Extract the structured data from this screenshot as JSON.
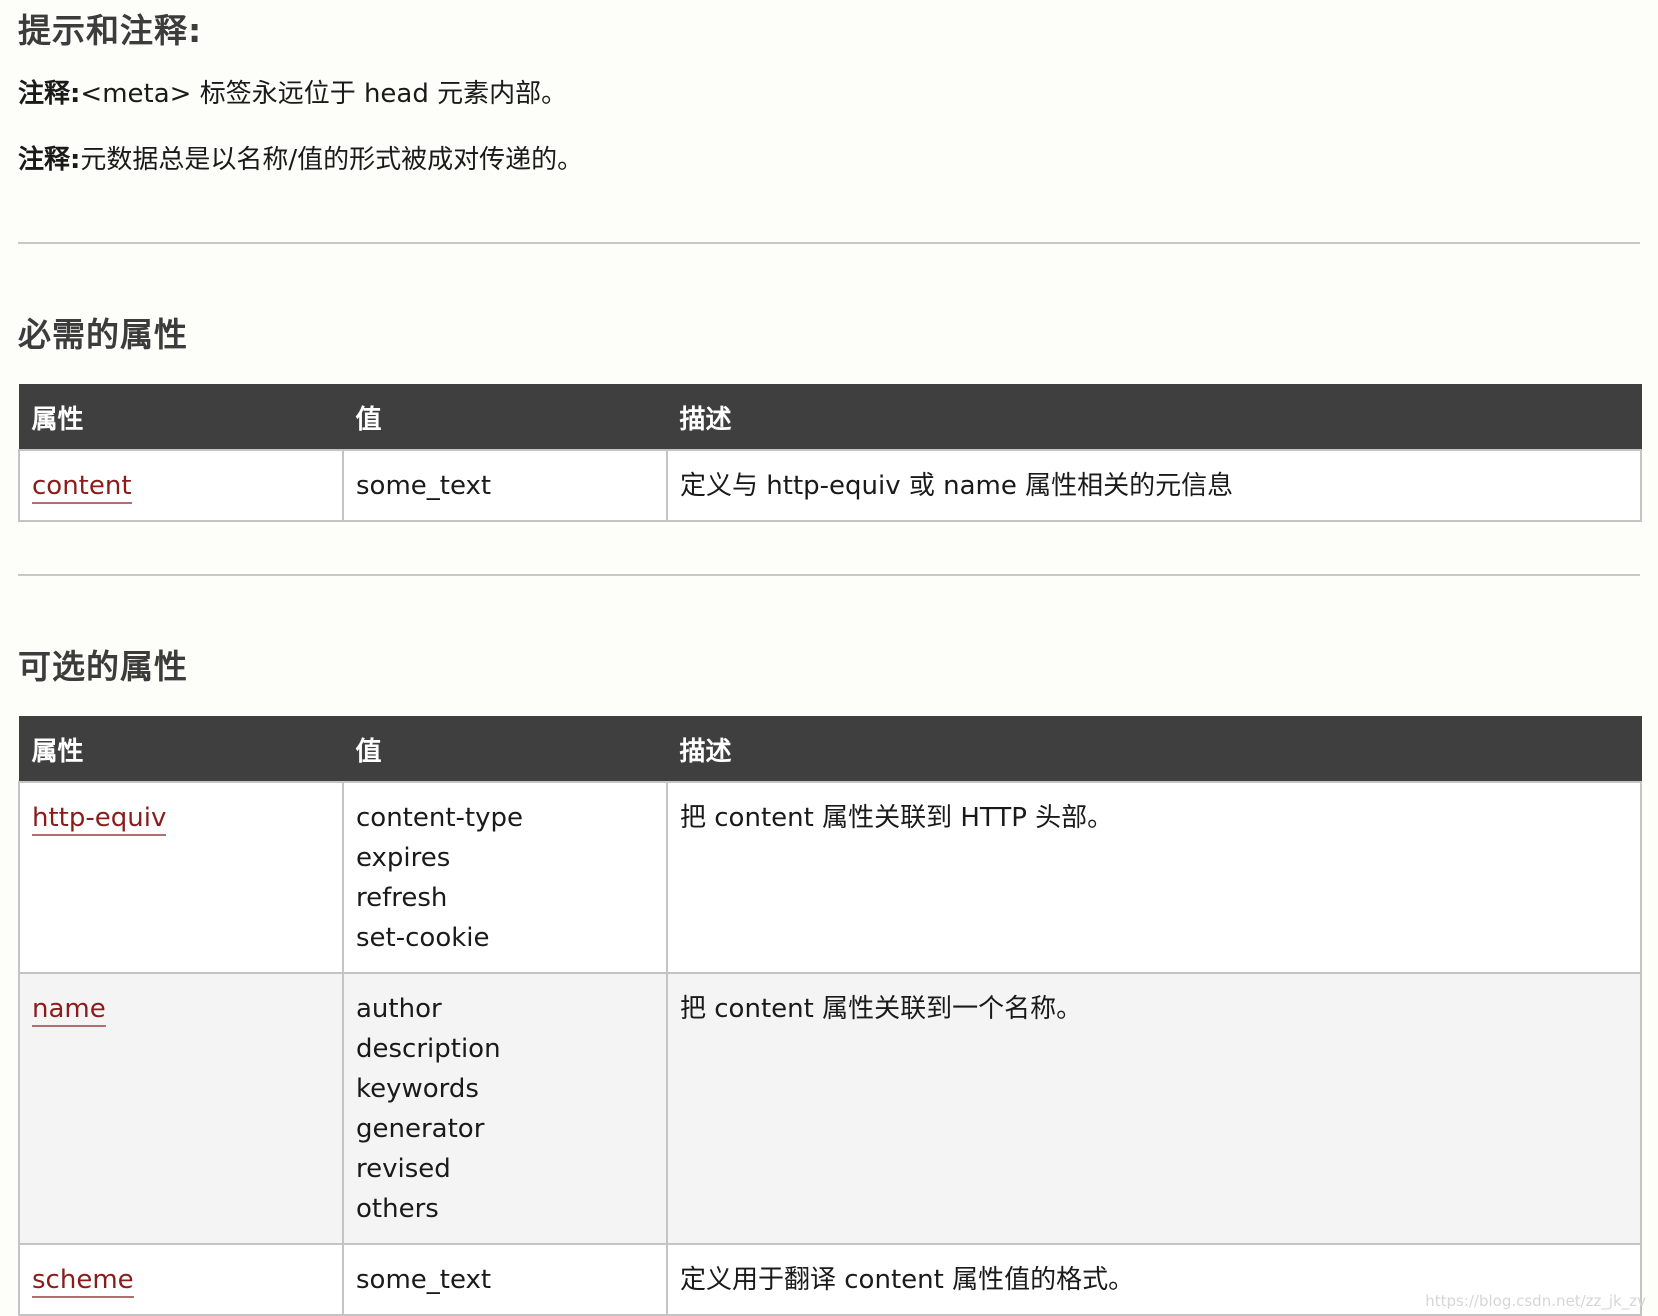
{
  "tips": {
    "title": "提示和注释:",
    "notes": [
      {
        "label": "注释:",
        "text": "<meta> 标签永远位于 head 元素内部。"
      },
      {
        "label": "注释:",
        "text": "元数据总是以名称/值的形式被成对传递的。"
      }
    ]
  },
  "required": {
    "title": "必需的属性",
    "headers": {
      "attr": "属性",
      "value": "值",
      "desc": "描述"
    },
    "rows": [
      {
        "attr": "content",
        "values": [
          "some_text"
        ],
        "desc": "定义与 http-equiv 或 name 属性相关的元信息"
      }
    ]
  },
  "optional": {
    "title": "可选的属性",
    "headers": {
      "attr": "属性",
      "value": "值",
      "desc": "描述"
    },
    "rows": [
      {
        "attr": "http-equiv",
        "values": [
          "content-type",
          "expires",
          "refresh",
          "set-cookie"
        ],
        "desc": "把 content 属性关联到 HTTP 头部。"
      },
      {
        "attr": "name",
        "values": [
          "author",
          "description",
          "keywords",
          "generator",
          "revised",
          "others"
        ],
        "desc": "把 content 属性关联到一个名称。"
      },
      {
        "attr": "scheme",
        "values": [
          "some_text"
        ],
        "desc": "定义用于翻译 content 属性值的格式。"
      }
    ]
  },
  "watermark": "https://blog.csdn.net/zz_jk_zv"
}
